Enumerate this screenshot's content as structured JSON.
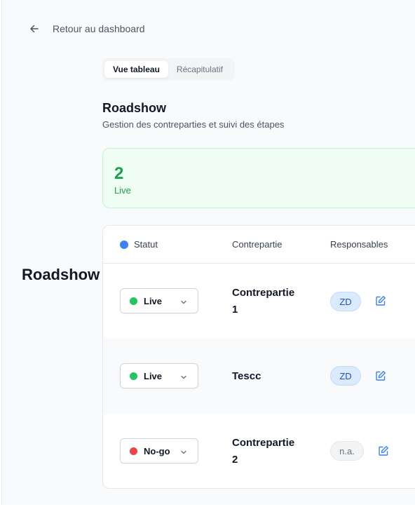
{
  "nav": {
    "back_label": "Retour au dashboard"
  },
  "tabs": [
    {
      "label": "Vue tableau",
      "active": true
    },
    {
      "label": "Récapitulatif",
      "active": false
    }
  ],
  "section": {
    "title": "Roadshow",
    "subtitle": "Gestion des contreparties et suivi des étapes"
  },
  "stat": {
    "value": "2",
    "label": "Live"
  },
  "side_title": "Roadshow",
  "table": {
    "headers": {
      "status": "Statut",
      "counterparty": "Contrepartie",
      "owners": "Responsables"
    },
    "rows": [
      {
        "status": "Live",
        "status_color": "#22c55e",
        "counterparty_line1": "Contrepartie",
        "counterparty_line2": "1",
        "owner": "ZD"
      },
      {
        "status": "Live",
        "status_color": "#22c55e",
        "counterparty_line1": "Tescc",
        "counterparty_line2": "",
        "owner": "ZD"
      },
      {
        "status": "No-go",
        "status_color": "#ef4444",
        "counterparty_line1": "Contrepartie",
        "counterparty_line2": "2",
        "owner": "n.a."
      }
    ]
  },
  "colors": {
    "accent": "#3b82f6",
    "success": "#16a34a",
    "danger": "#ef4444"
  }
}
